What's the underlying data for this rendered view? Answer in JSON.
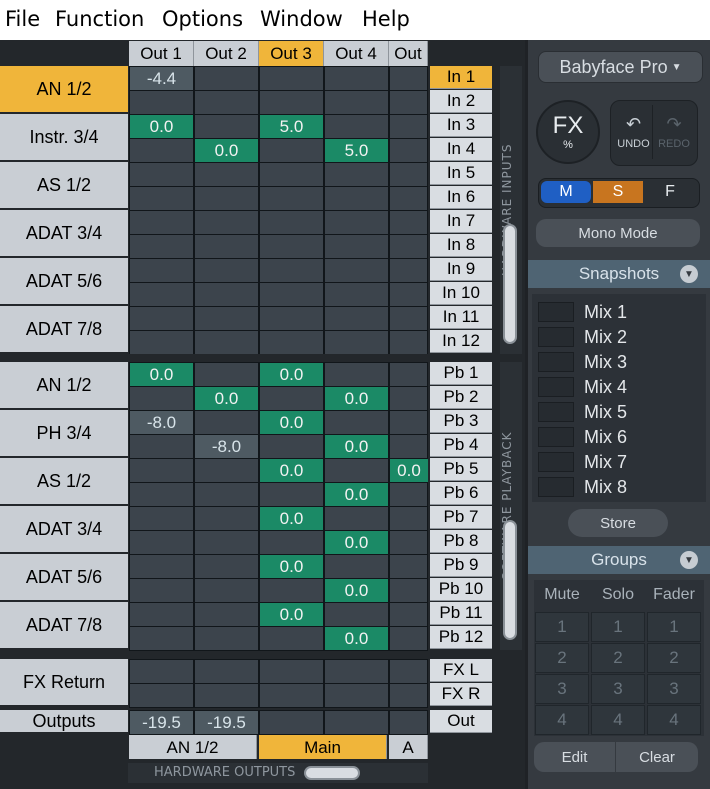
{
  "menu": [
    "File",
    "Function",
    "Options",
    "Window",
    "Help"
  ],
  "out_headers": [
    {
      "label": "Out 1",
      "selected": false
    },
    {
      "label": "Out 2",
      "selected": false
    },
    {
      "label": "Out 3",
      "selected": true
    },
    {
      "label": "Out 4",
      "selected": false
    },
    {
      "label": "Out",
      "selected": false
    }
  ],
  "hardware_inputs": {
    "tab_label": "HARDWARE INPUTS",
    "groups": [
      {
        "label": "AN 1/2",
        "selected": true
      },
      {
        "label": "Instr. 3/4",
        "selected": false
      },
      {
        "label": "AS 1/2",
        "selected": false
      },
      {
        "label": "ADAT 3/4",
        "selected": false
      },
      {
        "label": "ADAT 5/6",
        "selected": false
      },
      {
        "label": "ADAT 7/8",
        "selected": false
      }
    ],
    "channels": [
      {
        "label": "In 1",
        "selected": true
      },
      {
        "label": "In 2",
        "selected": false
      },
      {
        "label": "In 3",
        "selected": false
      },
      {
        "label": "In 4",
        "selected": false
      },
      {
        "label": "In 5",
        "selected": false
      },
      {
        "label": "In 6",
        "selected": false
      },
      {
        "label": "In 7",
        "selected": false
      },
      {
        "label": "In 8",
        "selected": false
      },
      {
        "label": "In 9",
        "selected": false
      },
      {
        "label": "In 10",
        "selected": false
      },
      {
        "label": "In 11",
        "selected": false
      },
      {
        "label": "In 12",
        "selected": false
      }
    ],
    "gains": [
      {
        "row": 0,
        "col": 0,
        "value": "-4.4"
      },
      {
        "row": 2,
        "col": 0,
        "value": "0.0"
      },
      {
        "row": 2,
        "col": 2,
        "value": "5.0"
      },
      {
        "row": 3,
        "col": 1,
        "value": "0.0"
      },
      {
        "row": 3,
        "col": 3,
        "value": "5.0"
      }
    ]
  },
  "software_playback": {
    "tab_label": "SOFTWARE PLAYBACK",
    "groups": [
      {
        "label": "AN 1/2",
        "selected": false
      },
      {
        "label": "PH 3/4",
        "selected": false
      },
      {
        "label": "AS 1/2",
        "selected": false
      },
      {
        "label": "ADAT 3/4",
        "selected": false
      },
      {
        "label": "ADAT 5/6",
        "selected": false
      },
      {
        "label": "ADAT 7/8",
        "selected": false
      }
    ],
    "channels": [
      {
        "label": "Pb 1",
        "selected": false
      },
      {
        "label": "Pb 2",
        "selected": false
      },
      {
        "label": "Pb 3",
        "selected": false
      },
      {
        "label": "Pb 4",
        "selected": false
      },
      {
        "label": "Pb 5",
        "selected": false
      },
      {
        "label": "Pb 6",
        "selected": false
      },
      {
        "label": "Pb 7",
        "selected": false
      },
      {
        "label": "Pb 8",
        "selected": false
      },
      {
        "label": "Pb 9",
        "selected": false
      },
      {
        "label": "Pb 10",
        "selected": false
      },
      {
        "label": "Pb 11",
        "selected": false
      },
      {
        "label": "Pb 12",
        "selected": false
      }
    ],
    "gains": [
      {
        "row": 0,
        "col": 0,
        "value": "0.0"
      },
      {
        "row": 0,
        "col": 2,
        "value": "0.0"
      },
      {
        "row": 1,
        "col": 1,
        "value": "0.0"
      },
      {
        "row": 1,
        "col": 3,
        "value": "0.0"
      },
      {
        "row": 2,
        "col": 0,
        "value": "-8.0"
      },
      {
        "row": 2,
        "col": 2,
        "value": "0.0"
      },
      {
        "row": 3,
        "col": 1,
        "value": "-8.0"
      },
      {
        "row": 3,
        "col": 3,
        "value": "0.0"
      },
      {
        "row": 4,
        "col": 2,
        "value": "0.0"
      },
      {
        "row": 4,
        "col": 4,
        "value": "0.0"
      },
      {
        "row": 5,
        "col": 3,
        "value": "0.0"
      },
      {
        "row": 6,
        "col": 2,
        "value": "0.0"
      },
      {
        "row": 7,
        "col": 3,
        "value": "0.0"
      },
      {
        "row": 8,
        "col": 2,
        "value": "0.0"
      },
      {
        "row": 9,
        "col": 3,
        "value": "0.0"
      },
      {
        "row": 10,
        "col": 2,
        "value": "0.0"
      },
      {
        "row": 11,
        "col": 3,
        "value": "0.0"
      }
    ]
  },
  "fx_return": {
    "label": "FX Return",
    "channels": [
      "FX L",
      "FX R"
    ]
  },
  "outputs": {
    "label": "Outputs",
    "channel": "Out",
    "levels": [
      "-19.5",
      "-19.5"
    ]
  },
  "bottom_pairs": [
    {
      "label": "AN 1/2",
      "selected": false
    },
    {
      "label": "Main",
      "selected": true
    },
    {
      "label": "A",
      "selected": false
    }
  ],
  "hardware_outputs_label": "HARDWARE OUTPUTS",
  "panel": {
    "device": "Babyface Pro",
    "fx_label": "FX",
    "fx_sub": "%",
    "undo": "UNDO",
    "redo": "REDO",
    "modes": [
      "M",
      "S",
      "F"
    ],
    "mono_mode": "Mono Mode",
    "snapshots_title": "Snapshots",
    "snapshots": [
      "Mix 1",
      "Mix 2",
      "Mix 3",
      "Mix 4",
      "Mix 5",
      "Mix 6",
      "Mix 7",
      "Mix 8"
    ],
    "store": "Store",
    "groups_title": "Groups",
    "group_columns": [
      "Mute",
      "Solo",
      "Fader"
    ],
    "group_numbers": [
      "1",
      "2",
      "3",
      "4"
    ],
    "edit": "Edit",
    "clear": "Clear"
  },
  "colors": {
    "selected": "#f0b53a",
    "gain_active": "#1b8a66",
    "mode_m": "#1f5fc4",
    "mode_s": "#c8751f"
  }
}
